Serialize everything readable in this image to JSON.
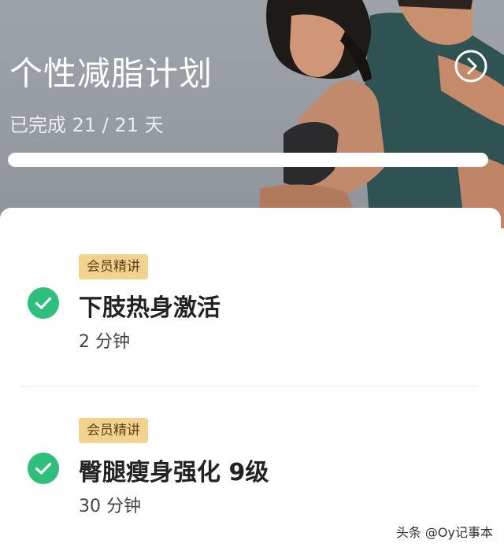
{
  "plan": {
    "title": "个性减脂计划",
    "progress_text": "已完成 21 / 21 天",
    "progress_fraction": 1.0,
    "detail_icon": "chevron-right-circle-icon",
    "hero_image": "two-athletes-photo"
  },
  "lessons": [
    {
      "badge": "会员精讲",
      "title": "下肢热身激活",
      "duration": "2 分钟",
      "status_icon": "check-circle-icon",
      "completed": true
    },
    {
      "badge": "会员精讲",
      "title": "臀腿瘦身强化 9级",
      "duration": "30 分钟",
      "status_icon": "check-circle-icon",
      "completed": true
    }
  ],
  "watermark": "头条 @Oy记事本",
  "colors": {
    "hero_bg": "#9ea2a9",
    "badge_bg": "#f2d28e",
    "badge_text": "#5b4416",
    "check_green": "#2dbf7b",
    "title_text": "#222222"
  }
}
